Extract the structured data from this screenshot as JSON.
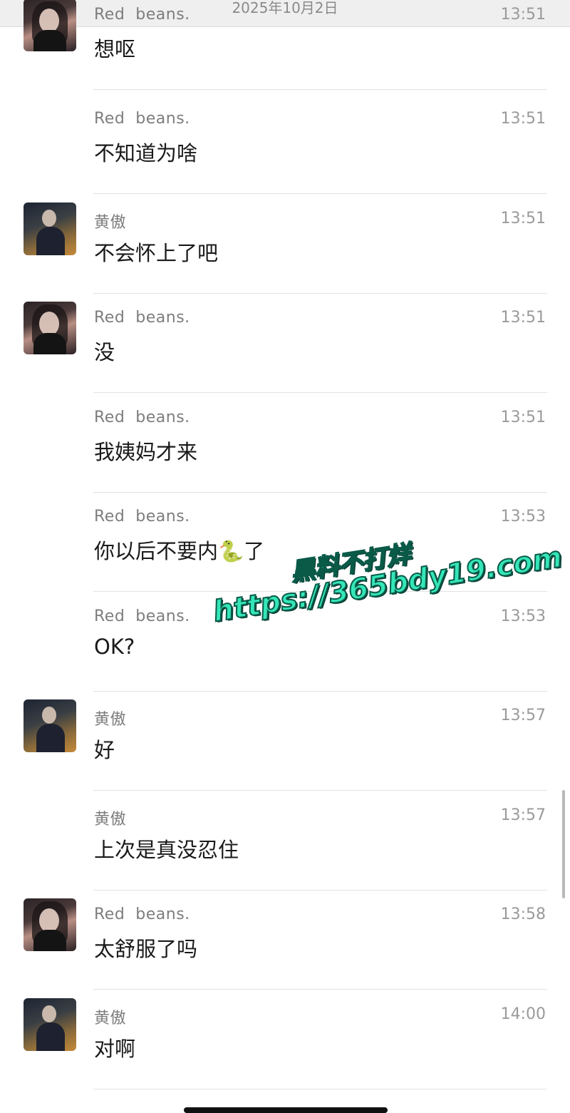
{
  "header": {
    "date": "2025年10月2日",
    "back_icon": "chevron-left-icon"
  },
  "messages": [
    {
      "sender": "Red  beans.",
      "time": "13:51",
      "text": "想呕",
      "avatar": "female"
    },
    {
      "sender": "Red  beans.",
      "time": "13:51",
      "text": "不知道为啥",
      "avatar": null
    },
    {
      "sender": "黄傲",
      "time": "13:51",
      "text": "不会怀上了吧",
      "avatar": "male"
    },
    {
      "sender": "Red  beans.",
      "time": "13:51",
      "text": "没",
      "avatar": "female"
    },
    {
      "sender": "Red  beans.",
      "time": "13:51",
      "text": "我姨妈才来",
      "avatar": null
    },
    {
      "sender": "Red  beans.",
      "time": "13:53",
      "text": "你以后不要内🐍了",
      "avatar": null
    },
    {
      "sender": "Red  beans.",
      "time": "13:53",
      "text": "OK?",
      "avatar": null
    },
    {
      "sender": "黄傲",
      "time": "13:57",
      "text": "好",
      "avatar": "male"
    },
    {
      "sender": "黄傲",
      "time": "13:57",
      "text": "上次是真没忍住",
      "avatar": null
    },
    {
      "sender": "Red  beans.",
      "time": "13:58",
      "text": "太舒服了吗",
      "avatar": "female"
    },
    {
      "sender": "黄傲",
      "time": "14:00",
      "text": "对啊",
      "avatar": "male"
    }
  ],
  "watermark": {
    "line1": "黑料不打烊",
    "line2": "https://365bdy19.com",
    "color": "#34e6b8"
  }
}
